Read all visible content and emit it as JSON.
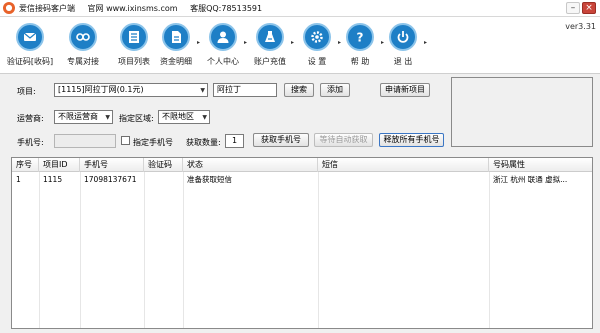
{
  "titlebar": {
    "app_name": "爱信接码客户端",
    "website": "官网 www.ixinsms.com",
    "qq": "客服QQ:78513591",
    "minimize": "–",
    "close": "×"
  },
  "version": "ver3.31",
  "toolbar": {
    "items": [
      {
        "label": "验证码[收码]",
        "icon": "sms-icon"
      },
      {
        "label": "专属对接",
        "icon": "link-icon"
      },
      {
        "label": "项目列表",
        "icon": "list-icon"
      },
      {
        "label": "资金明细",
        "icon": "document-icon"
      },
      {
        "label": "个人中心",
        "icon": "user-icon"
      },
      {
        "label": "账户充值",
        "icon": "recharge-icon"
      },
      {
        "label": "设 置",
        "icon": "gear-icon"
      },
      {
        "label": "帮 助",
        "icon": "help-icon"
      },
      {
        "label": "退 出",
        "icon": "power-icon"
      }
    ],
    "caret": "▸"
  },
  "form": {
    "project_label": "项目:",
    "project_value": "[1115]阿拉丁网(0.1元)",
    "project_name": "阿拉丁",
    "search_button": "搜索",
    "add_button": "添加",
    "apply_button": "申请新项目",
    "operator_label": "运营商:",
    "operator_value": "不限运营商",
    "region_label": "指定区域:",
    "region_value": "不限地区",
    "phone_label": "手机号:",
    "phone_value": "",
    "specify_phone_label": "指定手机号",
    "count_label": "获取数量:",
    "count_value": "1",
    "get_phone_button": "获取手机号",
    "auto_wait_button": "等待自动获取",
    "release_all_button": "释放所有手机号"
  },
  "table": {
    "headers": [
      "序号",
      "项目ID",
      "手机号",
      "验证码",
      "状态",
      "短信",
      "号码属性"
    ],
    "rows": [
      [
        "1",
        "1115",
        "17098137671",
        "",
        "准备获取短信",
        "",
        "浙江 杭州 联通 虚拟..."
      ]
    ]
  },
  "colors": {
    "accent": "#1e7fc6",
    "close_button": "#c9453a"
  }
}
